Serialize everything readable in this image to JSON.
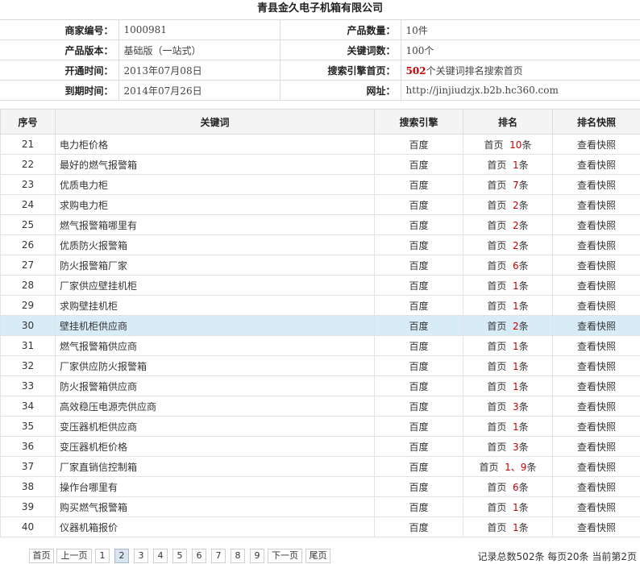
{
  "title": "青县金久电子机箱有限公司",
  "info": {
    "merchant_id_label": "商家编号：",
    "merchant_id": "1000981",
    "product_count_label": "产品数量：",
    "product_count": "10件",
    "version_label": "产品版本：",
    "version": "基础版（一站式）",
    "keyword_count_label": "关键词数：",
    "keyword_count": "100个",
    "open_time_label": "开通时间：",
    "open_time": "2013年07月08日",
    "engine_home_label": "搜索引擎首页：",
    "engine_home_num": "502",
    "engine_home_text": "个关键词排名搜索首页",
    "expire_label": "到期时间：",
    "expire_time": "2014年07月26日",
    "url_label": "网址：",
    "url": "http://jinjiudzjx.b2b.hc360.com"
  },
  "table": {
    "headers": [
      "序号",
      "关键词",
      "搜索引擎",
      "排名",
      "排名快照"
    ],
    "rows": [
      {
        "no": "21",
        "kw": "电力柜价格",
        "engine": "百度",
        "pre": "首页",
        "rank": "10",
        "post": "条",
        "snap": "查看快照"
      },
      {
        "no": "22",
        "kw": "最好的燃气报警箱",
        "engine": "百度",
        "pre": "首页",
        "rank": "1",
        "post": "条",
        "snap": "查看快照"
      },
      {
        "no": "23",
        "kw": "优质电力柜",
        "engine": "百度",
        "pre": "首页",
        "rank": "7",
        "post": "条",
        "snap": "查看快照"
      },
      {
        "no": "24",
        "kw": "求购电力柜",
        "engine": "百度",
        "pre": "首页",
        "rank": "2",
        "post": "条",
        "snap": "查看快照"
      },
      {
        "no": "25",
        "kw": "燃气报警箱哪里有",
        "engine": "百度",
        "pre": "首页",
        "rank": "2",
        "post": "条",
        "snap": "查看快照"
      },
      {
        "no": "26",
        "kw": "优质防火报警箱",
        "engine": "百度",
        "pre": "首页",
        "rank": "2",
        "post": "条",
        "snap": "查看快照"
      },
      {
        "no": "27",
        "kw": "防火报警箱厂家",
        "engine": "百度",
        "pre": "首页",
        "rank": "6",
        "post": "条",
        "snap": "查看快照"
      },
      {
        "no": "28",
        "kw": "厂家供应壁挂机柜",
        "engine": "百度",
        "pre": "首页",
        "rank": "1",
        "post": "条",
        "snap": "查看快照"
      },
      {
        "no": "29",
        "kw": "求购壁挂机柜",
        "engine": "百度",
        "pre": "首页",
        "rank": "1",
        "post": "条",
        "snap": "查看快照"
      },
      {
        "no": "30",
        "kw": "壁挂机柜供应商",
        "engine": "百度",
        "pre": "首页",
        "rank": "2",
        "post": "条",
        "snap": "查看快照",
        "highlight": true
      },
      {
        "no": "31",
        "kw": "燃气报警箱供应商",
        "engine": "百度",
        "pre": "首页",
        "rank": "1",
        "post": "条",
        "snap": "查看快照"
      },
      {
        "no": "32",
        "kw": "厂家供应防火报警箱",
        "engine": "百度",
        "pre": "首页",
        "rank": "1",
        "post": "条",
        "snap": "查看快照"
      },
      {
        "no": "33",
        "kw": "防火报警箱供应商",
        "engine": "百度",
        "pre": "首页",
        "rank": "1",
        "post": "条",
        "snap": "查看快照"
      },
      {
        "no": "34",
        "kw": "高效稳压电源壳供应商",
        "engine": "百度",
        "pre": "首页",
        "rank": "3",
        "post": "条",
        "snap": "查看快照"
      },
      {
        "no": "35",
        "kw": "变压器机柜供应商",
        "engine": "百度",
        "pre": "首页",
        "rank": "1",
        "post": "条",
        "snap": "查看快照"
      },
      {
        "no": "36",
        "kw": "变压器机柜价格",
        "engine": "百度",
        "pre": "首页",
        "rank": "3",
        "post": "条",
        "snap": "查看快照"
      },
      {
        "no": "37",
        "kw": "厂家直销信控制箱",
        "engine": "百度",
        "pre": "首页",
        "rank": "1、9",
        "post": "条",
        "snap": "查看快照"
      },
      {
        "no": "38",
        "kw": "操作台哪里有",
        "engine": "百度",
        "pre": "首页",
        "rank": "6",
        "post": "条",
        "snap": "查看快照"
      },
      {
        "no": "39",
        "kw": "购买燃气报警箱",
        "engine": "百度",
        "pre": "首页",
        "rank": "1",
        "post": "条",
        "snap": "查看快照"
      },
      {
        "no": "40",
        "kw": "仪器机箱报价",
        "engine": "百度",
        "pre": "首页",
        "rank": "1",
        "post": "条",
        "snap": "查看快照"
      }
    ]
  },
  "pager": {
    "first": "首页",
    "prev": "上一页",
    "pages": [
      "1",
      "2",
      "3",
      "4",
      "5",
      "6",
      "7",
      "8",
      "9"
    ],
    "current": "2",
    "next": "下一页",
    "last": "尾页",
    "summary": "记录总数502条 每页20条 当前第2页"
  },
  "colors": {
    "highlight_row": "#d8ecf8",
    "rank_red": "#cc0000",
    "header_bg": "#f4f4f4"
  }
}
